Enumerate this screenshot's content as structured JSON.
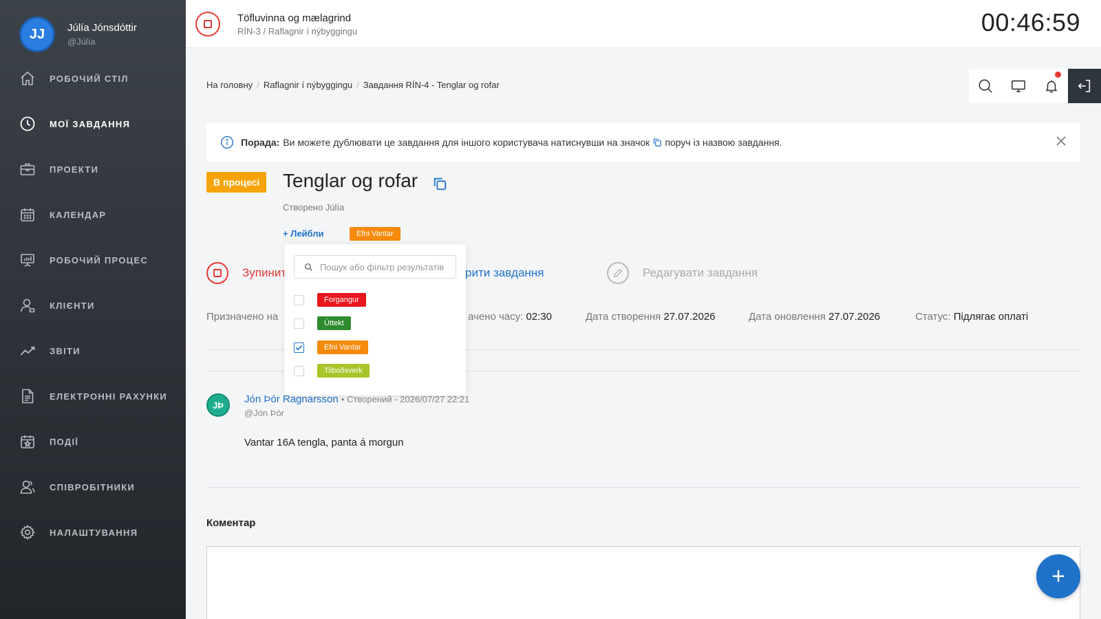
{
  "user": {
    "initials": "JJ",
    "name": "Júlía Jónsdóttir",
    "handle": "@Júlía"
  },
  "sidebar": {
    "items": [
      {
        "label": "РОБОЧИЙ СТІЛ",
        "icon": "home-icon"
      },
      {
        "label": "МОЇ ЗАВДАННЯ",
        "icon": "clock-icon",
        "active": true
      },
      {
        "label": "ПРОЕКТИ",
        "icon": "briefcase-icon"
      },
      {
        "label": "КАЛЕНДАР",
        "icon": "calendar-icon"
      },
      {
        "label": "РОБОЧИЙ ПРОЦЕС",
        "icon": "presentation-icon"
      },
      {
        "label": "КЛІЄНТИ",
        "icon": "user-icon"
      },
      {
        "label": "ЗВІТИ",
        "icon": "trend-icon"
      },
      {
        "label": "ЕЛЕКТРОННІ РАХУНКИ",
        "icon": "document-icon"
      },
      {
        "label": "ПОДІЇ",
        "icon": "calendar-star-icon"
      },
      {
        "label": "СПІВРОБІТНИКИ",
        "icon": "users-icon"
      },
      {
        "label": "НАЛАШТУВАННЯ",
        "icon": "gear-icon"
      }
    ]
  },
  "topbar": {
    "title": "Töfluvinna og mælagrind",
    "subtitle": "RÍN-3 / Raflagnir í nýbyggingu",
    "timer": "00:46:59"
  },
  "breadcrumb": {
    "items": [
      "На головну",
      "Raflagnir í nýbyggingu",
      "Завдання RÍN-4 - Tenglar og rofar"
    ]
  },
  "tip": {
    "label": "Порада:",
    "text_before": "Ви можете дублювати це завдання для іншого користувача натиснувши на значок",
    "text_after": "поруч із назвою завдання."
  },
  "task": {
    "status": "В процесі",
    "title": "Tenglar og rofar",
    "created_by": "Створено Júlía",
    "labels_link": "+ Лейбли",
    "label": "Efni Vantar",
    "label_color": "#f58a0b"
  },
  "actions": {
    "stop": "Зупинити",
    "close": "рити завдання",
    "edit": "Редагувати завдання"
  },
  "info": {
    "assigned_label": "Призначено на",
    "time_label": "ачено часу:",
    "time_value": "02:30",
    "created_label": "Дата створення",
    "created_value": "27.07.2026",
    "updated_label": "Дата оновлення",
    "updated_value": "27.07.2026",
    "status_label": "Статус:",
    "status_value": "Підлягає оплаті"
  },
  "comment": {
    "initials": "JÞ",
    "author": "Jón Þór Ragnarsson",
    "meta": "• Створений - 2026/07/27 22:21",
    "handle": "@Jón Þór",
    "text": "Vantar 16A tengla, panta á morgun"
  },
  "comment_form": {
    "title": "Коментар"
  },
  "fab": {
    "label": "+"
  },
  "dropdown": {
    "placeholder": "Пошук або фільтр результатів",
    "options": [
      {
        "label": "Forgangur",
        "color": "#e8171f",
        "checked": false
      },
      {
        "label": "Úttekt",
        "color": "#2e8b2e",
        "checked": false
      },
      {
        "label": "Efni Vantar",
        "color": "#f58a0b",
        "checked": true
      },
      {
        "label": "Tilboðsverk",
        "color": "#a8c52a",
        "checked": false
      }
    ]
  }
}
